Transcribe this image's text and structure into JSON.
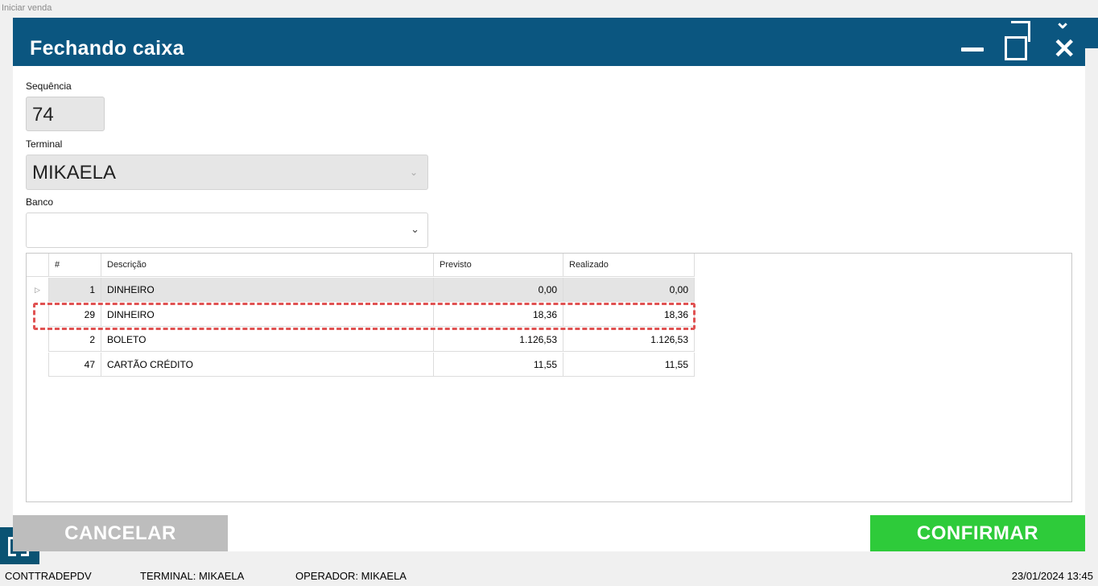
{
  "background": {
    "window_title": "Iniciar venda"
  },
  "dialog": {
    "title": "Fechando caixa",
    "sequencia": {
      "label": "Sequência",
      "value": "74"
    },
    "terminal": {
      "label": "Terminal",
      "value": "MIKAELA"
    },
    "banco": {
      "label": "Banco",
      "value": ""
    },
    "grid": {
      "columns": [
        "#",
        "Descrição",
        "Previsto",
        "Realizado"
      ],
      "rows": [
        {
          "num": "1",
          "desc": "DINHEIRO",
          "previsto": "0,00",
          "realizado": "0,00",
          "selected": true
        },
        {
          "num": "29",
          "desc": "DINHEIRO",
          "previsto": "18,36",
          "realizado": "18,36",
          "highlighted": true
        },
        {
          "num": "2",
          "desc": "BOLETO",
          "previsto": "1.126,53",
          "realizado": "1.126,53"
        },
        {
          "num": "47",
          "desc": "CARTÃO CRÉDITO",
          "previsto": "11,55",
          "realizado": "11,55"
        }
      ]
    },
    "buttons": {
      "cancel": "CANCELAR",
      "confirm": "CONFIRMAR"
    },
    "colors": {
      "titlebar": "#0b5680",
      "confirm": "#2ecb3a",
      "cancel": "#bdbdbd",
      "highlight": "#e05252"
    }
  },
  "statusbar": {
    "app": "CONTTRADEPDV",
    "terminal": "TERMINAL: MIKAELA",
    "operator": "OPERADOR: MIKAELA",
    "datetime": "23/01/2024 13:45"
  }
}
